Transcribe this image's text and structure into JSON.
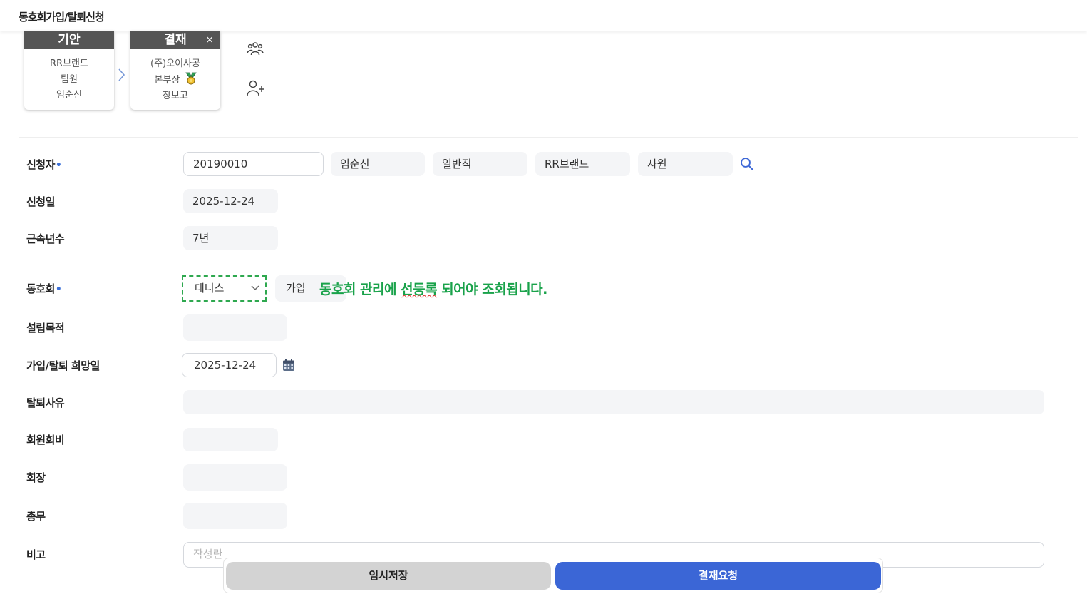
{
  "header": {
    "title": "동호회가입/탈퇴신청"
  },
  "approval": {
    "drafter": {
      "title": "기안",
      "lines": [
        "RR브랜드",
        "팀원",
        "임순신"
      ]
    },
    "approver": {
      "title": "결재",
      "close": "×",
      "lines": [
        "(주)오이사공",
        "본부장",
        "장보고"
      ]
    }
  },
  "form": {
    "applicant": {
      "label": "신청자",
      "required_mark": "•",
      "emp_no": "20190010",
      "name": "임순신",
      "job_type": "일반직",
      "dept": "RR브랜드",
      "position": "사원"
    },
    "apply_date": {
      "label": "신청일",
      "value": "2025-12-24"
    },
    "years": {
      "label": "근속년수",
      "value": "7년"
    },
    "club": {
      "label": "동호회",
      "required_mark": "•",
      "selected": "테니스",
      "type": "가입",
      "note_prefix": "동호회 관리에 ",
      "note_word": "선등록",
      "note_suffix": " 되어야 조회됩니다."
    },
    "purpose": {
      "label": "설립목적",
      "value": ""
    },
    "hope_date": {
      "label": "가입/탈퇴 희망일",
      "value": "2025-12-24"
    },
    "reason": {
      "label": "탈퇴사유",
      "value": ""
    },
    "fee": {
      "label": "회원회비",
      "value": ""
    },
    "president": {
      "label": "회장",
      "value": ""
    },
    "secretary": {
      "label": "총무",
      "value": ""
    },
    "remark": {
      "label": "비고",
      "placeholder": "작성란"
    }
  },
  "footer": {
    "save_label": "임시저장",
    "submit_label": "결재요청"
  },
  "icons": [
    "people-icon",
    "add-user-icon",
    "search-icon",
    "calendar-icon",
    "chevron-right-icon",
    "medal-icon"
  ],
  "colors": {
    "primary": "#3b66d6",
    "note_green": "#19a24a",
    "required": "#3a6fd8"
  }
}
